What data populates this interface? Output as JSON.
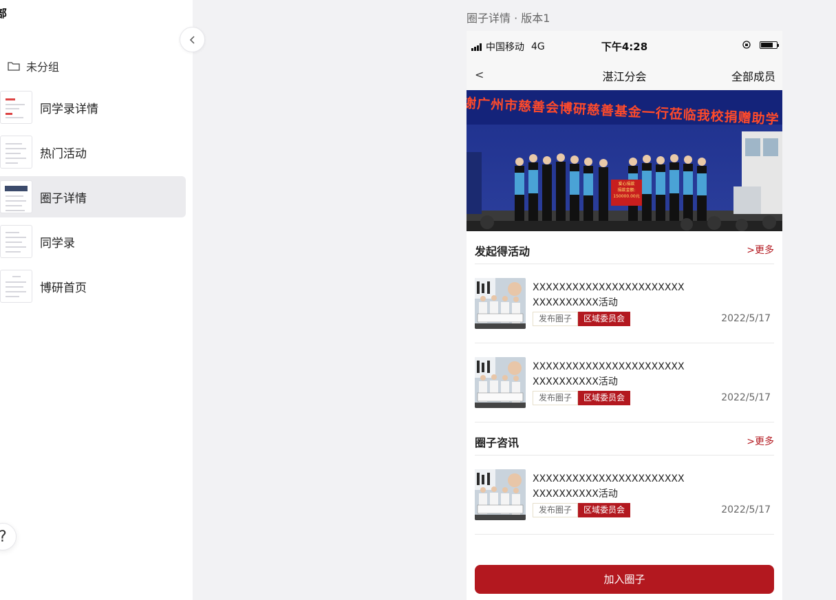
{
  "sidebar": {
    "title": "部",
    "group_label": "未分组",
    "pages": [
      {
        "label": "同学录详情"
      },
      {
        "label": "热门活动"
      },
      {
        "label": "圈子详情"
      },
      {
        "label": "同学录"
      },
      {
        "label": "博研首页"
      }
    ],
    "help_label": "?"
  },
  "frame": {
    "title": "圈子详情 · 版本1"
  },
  "phone": {
    "status": {
      "carrier": "中国移动",
      "network": "4G",
      "time": "下午4:28"
    },
    "nav": {
      "back": "<",
      "title": "湛江分会",
      "right": "全部成员"
    },
    "banner_caption": "感谢广州市慈善会博研慈善基金一行莅临我校捐赠助学",
    "banner_board": [
      "爱心捐款",
      "捐款金额: 150000.00元"
    ],
    "activities": {
      "title": "发起得活动",
      "more": ">更多",
      "items": [
        {
          "line1": "XXXXXXXXXXXXXXXXXXXXXXX",
          "line2": "XXXXXXXXXX活动",
          "tag1": "发布圈子",
          "tag2": "区域委员会",
          "date": "2022/5/17"
        },
        {
          "line1": "XXXXXXXXXXXXXXXXXXXXXXX",
          "line2": "XXXXXXXXXX活动",
          "tag1": "发布圈子",
          "tag2": "区域委员会",
          "date": "2022/5/17"
        }
      ]
    },
    "news": {
      "title": "圈子咨讯",
      "more": ">更多",
      "items": [
        {
          "line1": "XXXXXXXXXXXXXXXXXXXXXXX",
          "line2": "XXXXXXXXXX活动",
          "tag1": "发布圈子",
          "tag2": "区域委员会",
          "date": "2022/5/17"
        }
      ]
    },
    "join_button": "加入圈子"
  }
}
